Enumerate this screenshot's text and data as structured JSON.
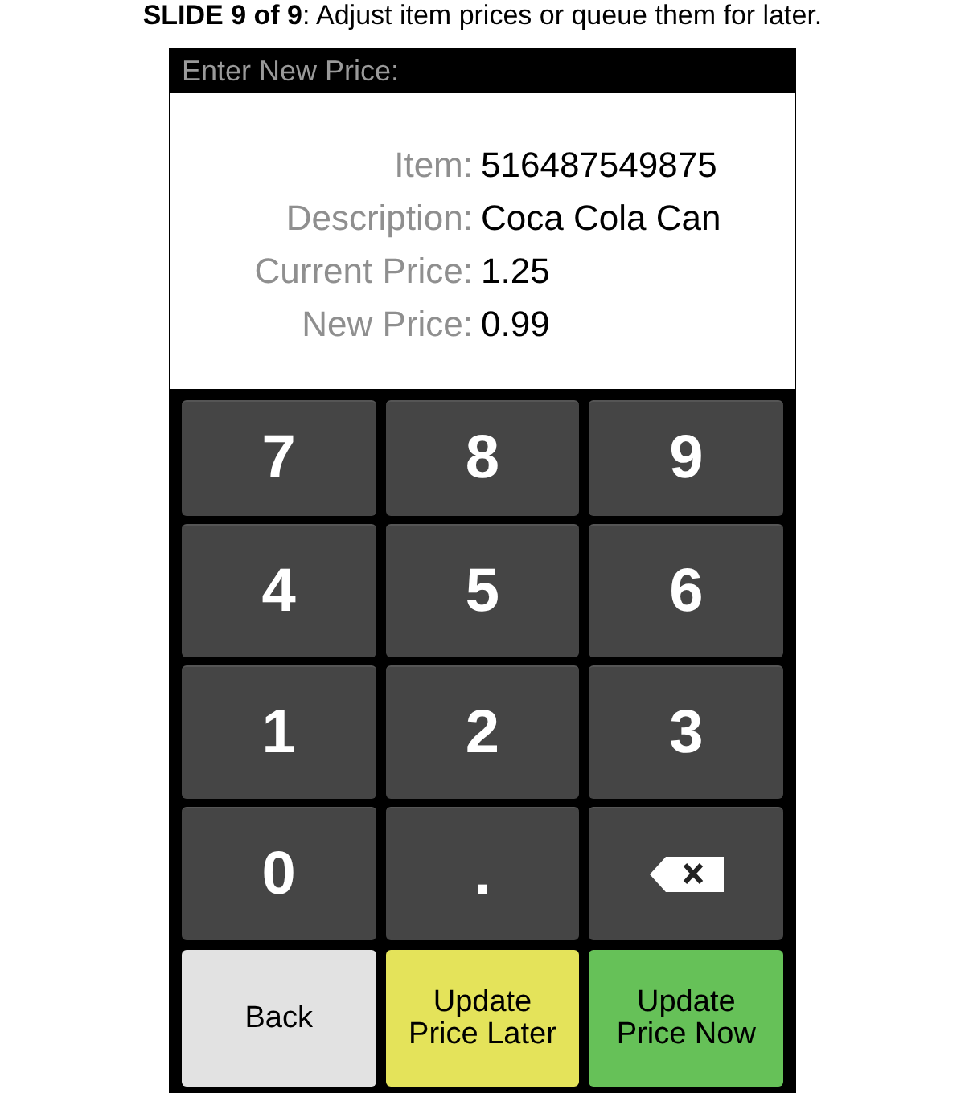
{
  "caption": "**SLIDE 9 of 9**: Adjust item prices or queue them for later.",
  "header": {
    "title": "Enter New Price:"
  },
  "fields": [
    {
      "label": "Item:",
      "value": "516487549875"
    },
    {
      "label": "Description:",
      "value": "Coca Cola Can"
    },
    {
      "label": "Current Price:",
      "value": "1.25"
    },
    {
      "label": "New Price:",
      "value": "0.99"
    }
  ],
  "keypad": [
    {
      "kind": "key",
      "label": "7"
    },
    {
      "kind": "key",
      "label": "8"
    },
    {
      "kind": "key",
      "label": "9"
    },
    {
      "kind": "key",
      "label": "4"
    },
    {
      "kind": "key",
      "label": "5"
    },
    {
      "kind": "key",
      "label": "6"
    },
    {
      "kind": "key",
      "label": "1"
    },
    {
      "kind": "key",
      "label": "2"
    },
    {
      "kind": "key",
      "label": "3"
    },
    {
      "kind": "key",
      "label": "0"
    },
    {
      "kind": "key",
      "label": "."
    },
    {
      "kind": "backspace"
    }
  ],
  "actions": [
    {
      "label": "Back",
      "color": "#e2e2e2"
    },
    {
      "label": "Update Price Later",
      "color": "#e4e35a"
    },
    {
      "label": "Update Price Now",
      "color": "#66c158"
    }
  ]
}
